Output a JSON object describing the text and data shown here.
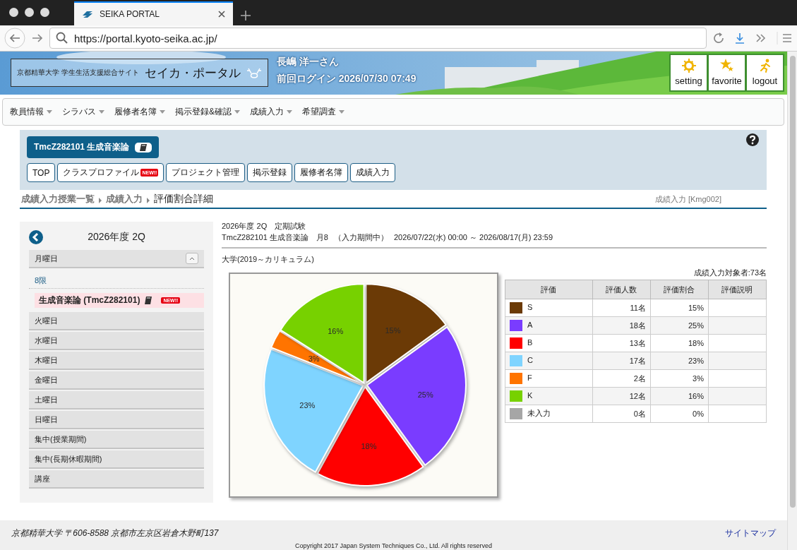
{
  "browser": {
    "tab_title": "SEIKA PORTAL",
    "url": "https://portal.kyoto-seika.ac.jp/"
  },
  "header": {
    "logo_subtitle": "京都精華大学 学生生活支援総合サイト",
    "logo_title": "セイカ・ポータル",
    "user_name": "長嶋 洋一さん",
    "last_login": "前回ログイン 2026/07/30 07:49",
    "buttons": [
      {
        "label": "setting",
        "kind": "setting"
      },
      {
        "label": "favorite",
        "kind": "favorite"
      },
      {
        "label": "logout",
        "kind": "logout"
      }
    ]
  },
  "menu": [
    "教員情報",
    "シラバス",
    "履修者名簿",
    "掲示登録&確認",
    "成績入力",
    "希望調査"
  ],
  "course": {
    "title": "TmcZ282101 生成音楽論",
    "tabs": [
      {
        "label": "TOP"
      },
      {
        "label": "クラスプロファイル",
        "badge": "NEW!!"
      },
      {
        "label": "プロジェクト管理"
      },
      {
        "label": "掲示登録"
      },
      {
        "label": "履修者名簿"
      },
      {
        "label": "成績入力"
      }
    ]
  },
  "breadcrumb": {
    "links": [
      "成績入力授業一覧",
      "成績入力"
    ],
    "current": "評価割合詳細",
    "screen_id": "成績入力 [Kmg002]"
  },
  "sidebar": {
    "title": "2026年度 2Q",
    "days": [
      {
        "label": "月曜日",
        "expanded": true,
        "periods": [
          {
            "label": "8限",
            "courses": [
              {
                "label": "生成音楽論 (TmcZ282101)",
                "badge": "NEW!!",
                "selected": true
              }
            ]
          }
        ]
      },
      {
        "label": "火曜日",
        "expanded": false
      },
      {
        "label": "水曜日",
        "expanded": false
      },
      {
        "label": "木曜日",
        "expanded": false
      },
      {
        "label": "金曜日",
        "expanded": false
      },
      {
        "label": "土曜日",
        "expanded": false
      },
      {
        "label": "日曜日",
        "expanded": false
      },
      {
        "label": "集中(授業期間)",
        "expanded": false
      },
      {
        "label": "集中(長期休暇期間)",
        "expanded": false
      },
      {
        "label": "講座",
        "expanded": false
      }
    ]
  },
  "exam": {
    "term_line": "2026年度 2Q　定期試験",
    "course_line": "TmcZ282101 生成音楽論　月8",
    "status": "（入力期間中）",
    "period": "2026/07/22(水) 00:00 ～ 2026/08/17(月) 23:59",
    "curriculum": "大学(2019～カリキュラム)",
    "target_count": "成績入力対象者:73名"
  },
  "chart_data": {
    "type": "pie",
    "values": [
      15,
      25,
      18,
      23,
      3,
      16
    ],
    "value_labels": [
      "15%",
      "25%",
      "18%",
      "23%",
      "3%",
      "16%"
    ]
  },
  "grade_table": {
    "columns": [
      "評価",
      "評価人数",
      "評価割合",
      "評価説明"
    ],
    "rows": [
      {
        "grade": "S",
        "color": "#6b3a06",
        "count": "11名",
        "ratio": "15%"
      },
      {
        "grade": "A",
        "color": "#7a3cff",
        "count": "18名",
        "ratio": "25%"
      },
      {
        "grade": "B",
        "color": "#ff0000",
        "count": "13名",
        "ratio": "18%"
      },
      {
        "grade": "C",
        "color": "#7fd4ff",
        "count": "17名",
        "ratio": "23%"
      },
      {
        "grade": "F",
        "color": "#ff7400",
        "count": "2名",
        "ratio": "3%"
      },
      {
        "grade": "K",
        "color": "#77d100",
        "count": "12名",
        "ratio": "16%"
      },
      {
        "grade": "未入力",
        "color": "#a6a6a6",
        "count": "0名",
        "ratio": "0%"
      }
    ]
  },
  "footer": {
    "address": "京都精華大学 〒606-8588 京都市左京区岩倉木野町137",
    "sitemap": "サイトマップ",
    "copyright": "Copyright 2017 Japan System Techniques Co., Ltd. All rights reserved"
  }
}
